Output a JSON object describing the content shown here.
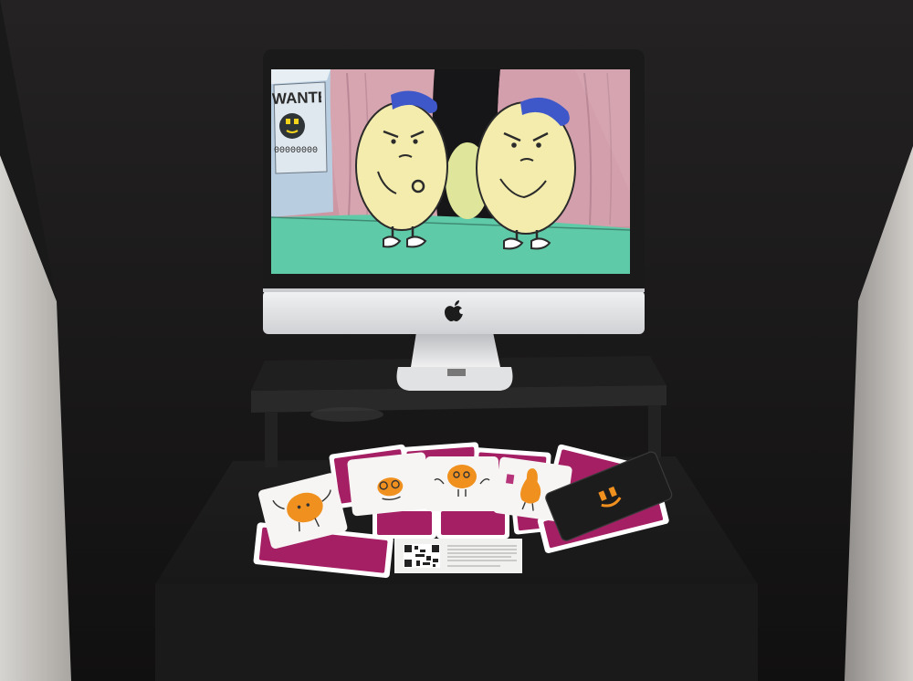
{
  "poster": {
    "title": "WANTED",
    "reward_digits": "00000000"
  },
  "colors": {
    "wall": "#171616",
    "screen_floor": "#5fcaa7",
    "curtain": "#cf9aa7",
    "character_body": "#f3ecac",
    "character_hat": "#3e58c9",
    "card_back": "#a51f64",
    "card_character": "#f0901e",
    "aluminum": "#e3e4e6"
  },
  "icons": {
    "monitor_logo": "apple-logo-icon",
    "placard_code": "qr-code-icon",
    "dark_card_symbol": "character-face-icon"
  }
}
